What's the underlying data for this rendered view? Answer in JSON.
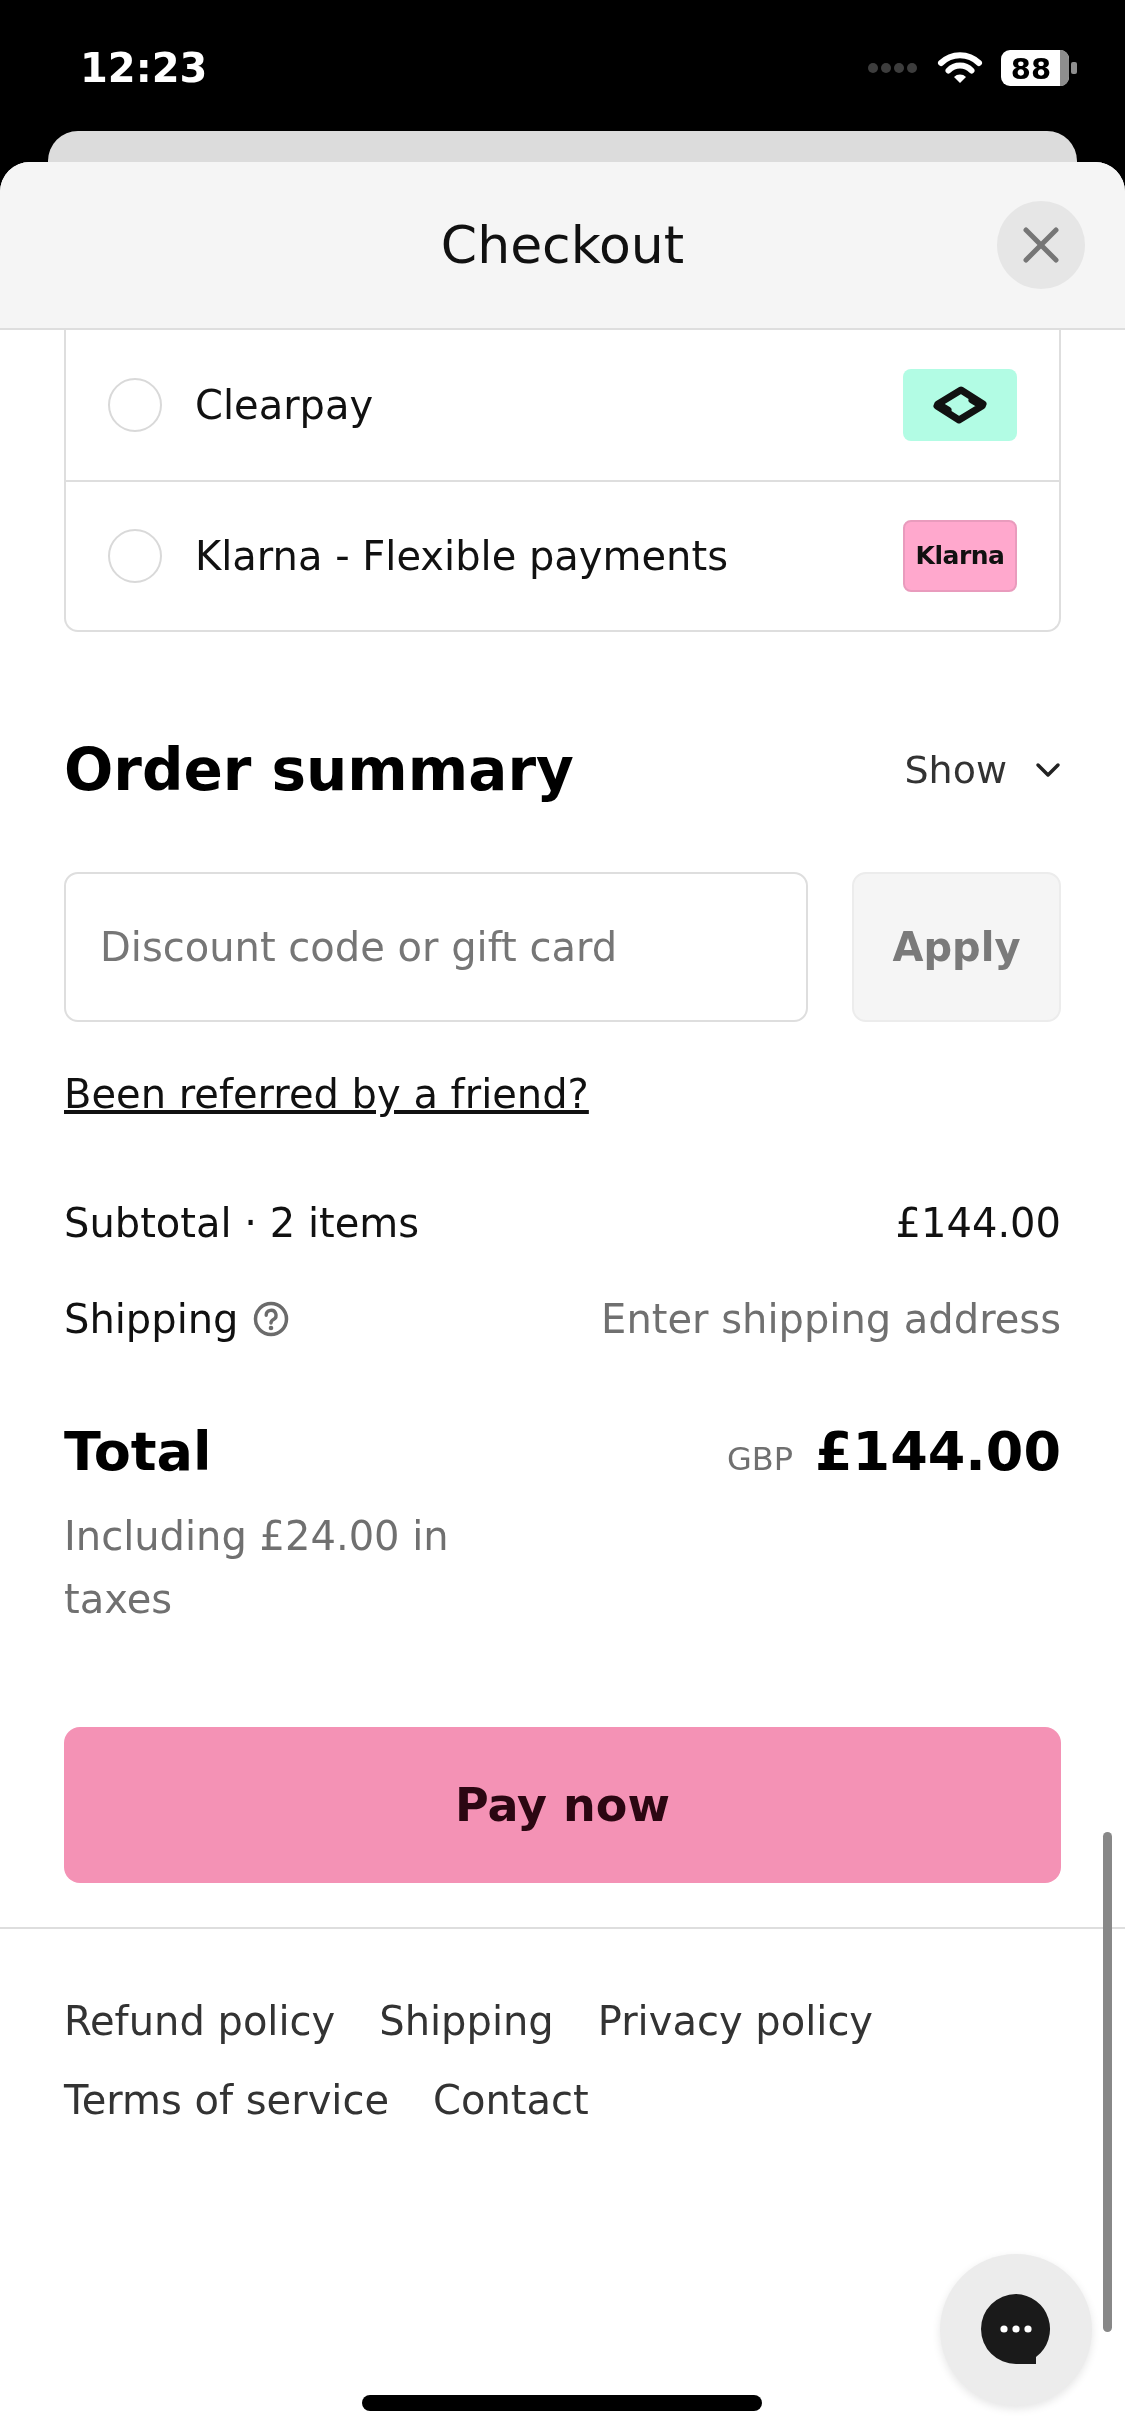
{
  "status_bar": {
    "time": "12:23",
    "battery": "88"
  },
  "sheet": {
    "title": "Checkout"
  },
  "payment_methods": [
    {
      "kind": "clearpay",
      "label": "Clearpay",
      "selected": false
    },
    {
      "kind": "klarna",
      "label": "Klarna - Flexible payments",
      "logo_text": "Klarna",
      "selected": false
    }
  ],
  "order_summary": {
    "title": "Order summary",
    "toggle": "Show",
    "expanded": false
  },
  "discount": {
    "placeholder": "Discount code or gift card",
    "button": "Apply",
    "disabled": true
  },
  "referral_link": "Been referred by a friend?",
  "summary_rows": [
    {
      "kind": "amount",
      "label": "Subtotal · 2 items",
      "value": "£144.00",
      "help": false
    },
    {
      "kind": "note",
      "label": "Shipping",
      "value": "Enter shipping address",
      "help": true
    }
  ],
  "total": {
    "label": "Total",
    "currency": "GBP",
    "amount": "£144.00",
    "tax_note": "Including £24.00 in taxes"
  },
  "pay_button": "Pay now",
  "footer_links": [
    "Refund policy",
    "Shipping",
    "Privacy policy",
    "Terms of service",
    "Contact"
  ]
}
